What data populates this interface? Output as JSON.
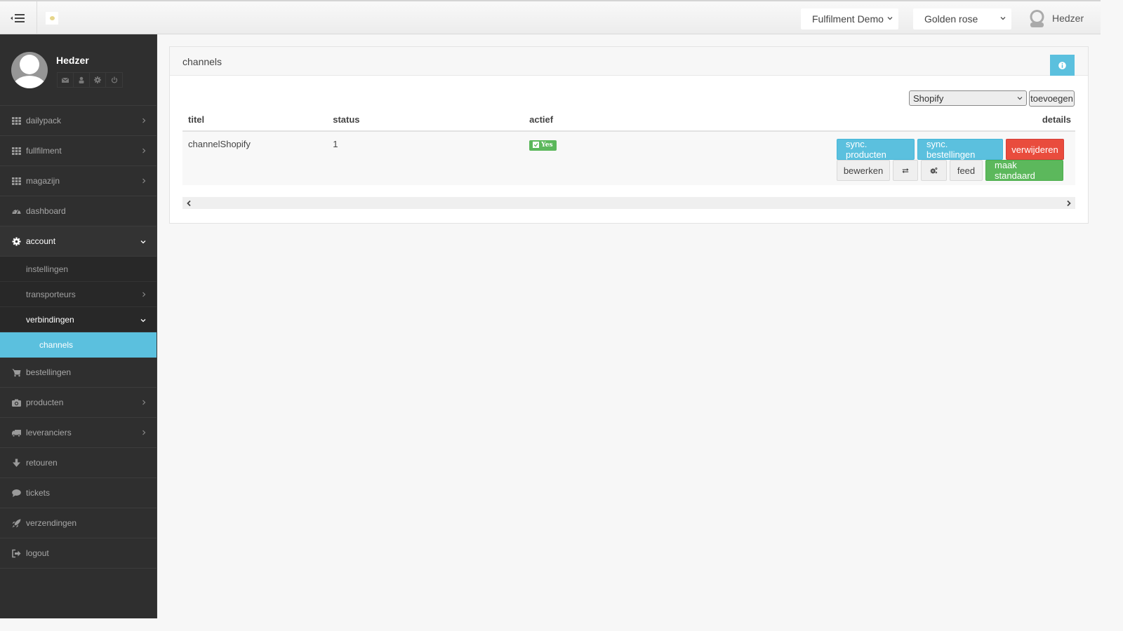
{
  "topbar": {
    "organisation_select": "Fulfilment Demo",
    "store_select": "Golden rose",
    "user_name": "Hedzer"
  },
  "sidebar": {
    "profile": {
      "name": "Hedzer",
      "actions": [
        "envelope-icon",
        "user-icon",
        "gear-icon",
        "power-icon"
      ]
    },
    "items": [
      {
        "label": "dailypack",
        "icon": "grid-icon",
        "has_arrow": true
      },
      {
        "label": "fullfilment",
        "icon": "grid-icon",
        "has_arrow": true
      },
      {
        "label": "magazijn",
        "icon": "grid-icon",
        "has_arrow": true
      },
      {
        "label": "dashboard",
        "icon": "dashboard-icon",
        "has_arrow": false
      },
      {
        "label": "account",
        "icon": "gear-icon",
        "expanded": true,
        "children": [
          {
            "label": "instellingen"
          },
          {
            "label": "transporteurs",
            "has_arrow": true
          },
          {
            "label": "verbindingen",
            "expanded": true,
            "children": [
              {
                "label": "channels",
                "active": true
              }
            ]
          }
        ]
      },
      {
        "label": "bestellingen",
        "icon": "cart-icon",
        "has_arrow": false
      },
      {
        "label": "producten",
        "icon": "camera-icon",
        "has_arrow": true
      },
      {
        "label": "leveranciers",
        "icon": "truck-icon",
        "has_arrow": true
      },
      {
        "label": "retouren",
        "icon": "arrow-down-icon",
        "has_arrow": false
      },
      {
        "label": "tickets",
        "icon": "comment-icon",
        "has_arrow": false
      },
      {
        "label": "verzendingen",
        "icon": "rocket-icon",
        "has_arrow": false
      },
      {
        "label": "logout",
        "icon": "sign-out-icon",
        "has_arrow": false
      }
    ]
  },
  "panel": {
    "title": "channels",
    "channel_type_select": "Shopify",
    "add_button": "toevoegen",
    "table": {
      "headers": [
        "titel",
        "status",
        "actief",
        "details"
      ],
      "rows": [
        {
          "titel": "channelShopify",
          "status": "1",
          "actief": "Yes",
          "actions": {
            "sync_products": "sync. producten",
            "sync_orders": "sync. bestellingen",
            "delete": "verwijderen",
            "edit": "bewerken",
            "feed": "feed",
            "make_default": "maak standaard"
          }
        }
      ]
    }
  },
  "colors": {
    "sidebar_bg": "#2f2f2f",
    "active_item": "#5bc0de",
    "info": "#5bc0de",
    "danger": "#e94c3d",
    "success": "#5cb85c"
  }
}
